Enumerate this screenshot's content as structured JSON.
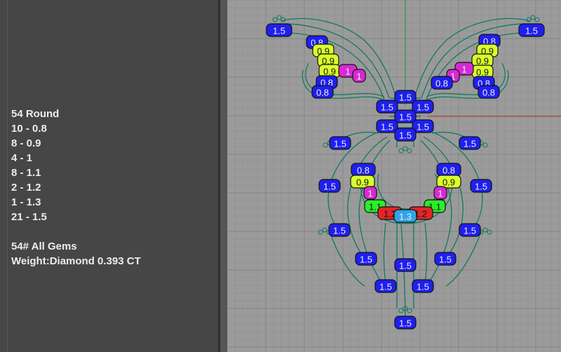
{
  "info": {
    "title": "54 Round",
    "breakdown": [
      "10 - 0.8",
      "8 - 0.9",
      "4 - 1",
      "8 - 1.1",
      "2 - 1.2",
      "1 - 1.3",
      "21 - 1.5"
    ],
    "summary_title": "54# All Gems",
    "weight": "Weight:Diamond 0.393 CT"
  },
  "gem_colors": {
    "0.8": "#1f1ff0",
    "0.9": "#d9ff2a",
    "1": "#d52ad5",
    "1.1": "#2aee2a",
    "1.2": "#e22626",
    "1.3": "#2fa4e8",
    "1.5": "#1f1ff0"
  },
  "gems": [
    {
      "label": "1.5",
      "size": "1.5"
    },
    {
      "label": "1.5",
      "size": "1.5"
    },
    {
      "label": "0.8",
      "size": "0.8"
    },
    {
      "label": "0.9",
      "size": "0.9"
    },
    {
      "label": "0.9",
      "size": "0.9"
    },
    {
      "label": "0.9",
      "size": "0.9"
    },
    {
      "label": "1",
      "size": "1"
    },
    {
      "label": "1",
      "size": "1"
    },
    {
      "label": "0.8",
      "size": "0.8"
    },
    {
      "label": "0.8",
      "size": "0.8"
    },
    {
      "label": "0.8",
      "size": "0.8"
    },
    {
      "label": "0.8",
      "size": "0.8"
    },
    {
      "label": "0.9",
      "size": "0.9"
    },
    {
      "label": "0.9",
      "size": "0.9"
    },
    {
      "label": "0.9",
      "size": "0.9"
    },
    {
      "label": "1",
      "size": "1"
    },
    {
      "label": "1",
      "size": "1"
    },
    {
      "label": "0.8",
      "size": "0.8"
    },
    {
      "label": "0.8",
      "size": "0.8"
    },
    {
      "label": "0.8",
      "size": "0.8"
    },
    {
      "label": "1.5",
      "size": "1.5"
    },
    {
      "label": "1.5",
      "size": "1.5"
    },
    {
      "label": "1.5",
      "size": "1.5"
    },
    {
      "label": "1.5",
      "size": "1.5"
    },
    {
      "label": "1.5",
      "size": "1.5"
    },
    {
      "label": "1.5",
      "size": "1.5"
    },
    {
      "label": "1.5",
      "size": "1.5"
    },
    {
      "label": "1.5",
      "size": "1.5"
    },
    {
      "label": "1.5",
      "size": "1.5"
    },
    {
      "label": "1.5",
      "size": "1.5"
    },
    {
      "label": "1.5",
      "size": "1.5"
    },
    {
      "label": "0.8",
      "size": "0.8"
    },
    {
      "label": "0.9",
      "size": "0.9"
    },
    {
      "label": "1",
      "size": "1"
    },
    {
      "label": "1.1",
      "size": "1.1"
    },
    {
      "label": "1.2",
      "size": "1.2"
    },
    {
      "label": "0.8",
      "size": "0.8"
    },
    {
      "label": "0.9",
      "size": "0.9"
    },
    {
      "label": "1",
      "size": "1"
    },
    {
      "label": "1.1",
      "size": "1.1"
    },
    {
      "label": "1.2",
      "size": "1.2"
    },
    {
      "label": "1.3",
      "size": "1.3"
    },
    {
      "label": "1.5",
      "size": "1.5"
    },
    {
      "label": "1.5",
      "size": "1.5"
    },
    {
      "label": "1.5",
      "size": "1.5"
    },
    {
      "label": "1.5",
      "size": "1.5"
    },
    {
      "label": "1.5",
      "size": "1.5"
    },
    {
      "label": "1.5",
      "size": "1.5"
    },
    {
      "label": "1.5",
      "size": "1.5"
    },
    {
      "label": "1.5",
      "size": "1.5"
    },
    {
      "label": "1.5",
      "size": "1.5"
    },
    {
      "label": "1.5",
      "size": "1.5"
    }
  ]
}
